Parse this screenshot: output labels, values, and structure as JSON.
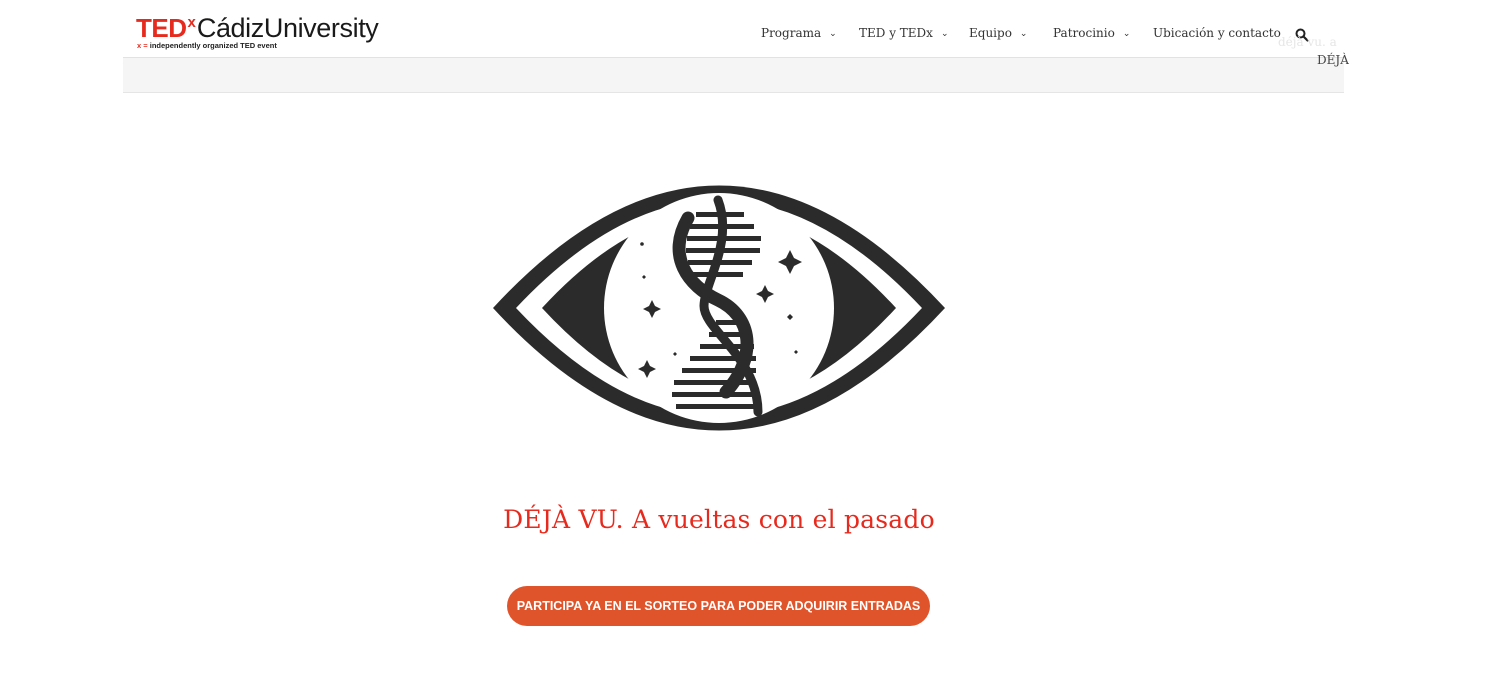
{
  "logo": {
    "ted": "TED",
    "x": "x",
    "name": "CádizUniversity",
    "tag_prefix": "x =",
    "tag": "independently organized TED event"
  },
  "nav": {
    "items": [
      {
        "label": "Programa",
        "has_dropdown": true
      },
      {
        "label": "TED y TEDx",
        "has_dropdown": true
      },
      {
        "label": "Equipo",
        "has_dropdown": true
      },
      {
        "label": "Patrocinio",
        "has_dropdown": true
      },
      {
        "label": "Ubicación y contacto",
        "has_dropdown": false
      }
    ],
    "search_icon": "search-icon"
  },
  "breadcrumb": {
    "ghost": "déjà vu. a",
    "current": "DÉJÀ"
  },
  "hero": {
    "image": "eye-dna-logo"
  },
  "title": "DÉJÀ VU. A vueltas con el pasado",
  "cta": {
    "label": "PARTICIPA YA EN EL SORTEO PARA PODER ADQUIRIR ENTRADAS"
  },
  "colors": {
    "brand_red": "#e62b1e",
    "cta_orange": "#e0542b",
    "logo_dark": "#2b2b2b"
  }
}
